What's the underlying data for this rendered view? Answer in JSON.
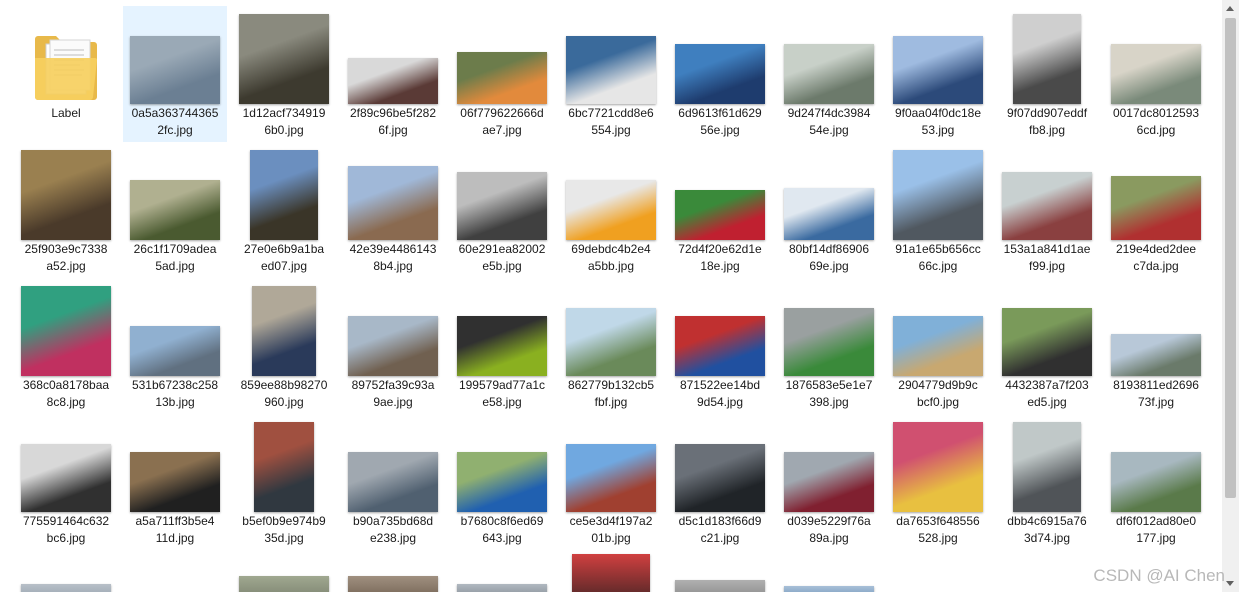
{
  "folder": {
    "name": "Label",
    "icon": "folder-icon"
  },
  "files": [
    {
      "line1": "0a5a363744365",
      "line2": "2fc.jpg",
      "c1": "#6b7f93",
      "c2": "#9aa9b6",
      "w": 90,
      "h": 68
    },
    {
      "line1": "1d12acf734919",
      "line2": "6b0.jpg",
      "c1": "#3d3a2f",
      "c2": "#8a8a7e",
      "w": 90,
      "h": 90
    },
    {
      "line1": "2f89c96be5f282",
      "line2": "6f.jpg",
      "c1": "#5a3a36",
      "c2": "#d9d9d9",
      "w": 90,
      "h": 46
    },
    {
      "line1": "06f779622666d",
      "line2": "ae7.jpg",
      "c1": "#e28a3c",
      "c2": "#6c7c4b",
      "w": 90,
      "h": 52
    },
    {
      "line1": "6bc7721cdd8e6",
      "line2": "554.jpg",
      "c1": "#e6e6e6",
      "c2": "#3a6a9b",
      "w": 90,
      "h": 68
    },
    {
      "line1": "6d9613f61d629",
      "line2": "56e.jpg",
      "c1": "#1e3c6e",
      "c2": "#3f7fbf",
      "w": 90,
      "h": 60
    },
    {
      "line1": "9d247f4dc3984",
      "line2": "54e.jpg",
      "c1": "#6c7a6b",
      "c2": "#c8d0c8",
      "w": 90,
      "h": 60
    },
    {
      "line1": "9f0aa04f0dc18e",
      "line2": "53.jpg",
      "c1": "#2c4a7a",
      "c2": "#9fbbe0",
      "w": 90,
      "h": 68
    },
    {
      "line1": "9f07dd907eddf",
      "line2": "fb8.jpg",
      "c1": "#4a4a4a",
      "c2": "#cfcfcf",
      "w": 68,
      "h": 90
    },
    {
      "line1": "0017dc8012593",
      "line2": "6cd.jpg",
      "c1": "#7a8a7a",
      "c2": "#d8d4c8",
      "w": 90,
      "h": 60
    },
    {
      "line1": "25f903e9c7338",
      "line2": "a52.jpg",
      "c1": "#4a3a2a",
      "c2": "#9a8050",
      "w": 90,
      "h": 90
    },
    {
      "line1": "26c1f1709adea",
      "line2": "5ad.jpg",
      "c1": "#4a5a30",
      "c2": "#b0b090",
      "w": 90,
      "h": 60
    },
    {
      "line1": "27e0e6b9a1ba",
      "line2": "ed07.jpg",
      "c1": "#3a3528",
      "c2": "#6b8fbf",
      "w": 68,
      "h": 90
    },
    {
      "line1": "42e39e4486143",
      "line2": "8b4.jpg",
      "c1": "#8a6a50",
      "c2": "#a0b8d8",
      "w": 90,
      "h": 74
    },
    {
      "line1": "60e291ea82002",
      "line2": "e5b.jpg",
      "c1": "#404040",
      "c2": "#bdbdbd",
      "w": 90,
      "h": 68
    },
    {
      "line1": "69debdc4b2e4",
      "line2": "a5bb.jpg",
      "c1": "#f0a020",
      "c2": "#e8e8e8",
      "w": 90,
      "h": 60
    },
    {
      "line1": "72d4f20e62d1e",
      "line2": "18e.jpg",
      "c1": "#c02030",
      "c2": "#3a8a3a",
      "w": 90,
      "h": 50
    },
    {
      "line1": "80bf14df86906",
      "line2": "69e.jpg",
      "c1": "#3a6aa0",
      "c2": "#e0e8f0",
      "w": 90,
      "h": 52
    },
    {
      "line1": "91a1e65b656cc",
      "line2": "66c.jpg",
      "c1": "#505860",
      "c2": "#9ac0e8",
      "w": 90,
      "h": 90
    },
    {
      "line1": "153a1a841d1ae",
      "line2": "f99.jpg",
      "c1": "#8a4040",
      "c2": "#c8d0d0",
      "w": 90,
      "h": 68
    },
    {
      "line1": "219e4ded2dee",
      "line2": "c7da.jpg",
      "c1": "#b03030",
      "c2": "#8a9a60",
      "w": 90,
      "h": 64
    },
    {
      "line1": "368c0a8178baa",
      "line2": "8c8.jpg",
      "c1": "#c03060",
      "c2": "#30a080",
      "w": 90,
      "h": 90
    },
    {
      "line1": "531b67238c258",
      "line2": "13b.jpg",
      "c1": "#607080",
      "c2": "#90b0d0",
      "w": 90,
      "h": 50
    },
    {
      "line1": "859ee88b98270",
      "line2": "960.jpg",
      "c1": "#2a3a5a",
      "c2": "#b0a898",
      "w": 64,
      "h": 90
    },
    {
      "line1": "89752fa39c93a",
      "line2": "9ae.jpg",
      "c1": "#706050",
      "c2": "#a8b8c8",
      "w": 90,
      "h": 60
    },
    {
      "line1": "199579ad77a1c",
      "line2": "e58.jpg",
      "c1": "#8ab020",
      "c2": "#303030",
      "w": 90,
      "h": 60
    },
    {
      "line1": "862779b132cb5",
      "line2": "fbf.jpg",
      "c1": "#6a8a5a",
      "c2": "#c0d8e8",
      "w": 90,
      "h": 68
    },
    {
      "line1": "871522ee14bd",
      "line2": "9d54.jpg",
      "c1": "#2050a0",
      "c2": "#c03030",
      "w": 90,
      "h": 60
    },
    {
      "line1": "1876583e5e1e7",
      "line2": "398.jpg",
      "c1": "#3a8a3a",
      "c2": "#9aa0a0",
      "w": 90,
      "h": 68
    },
    {
      "line1": "2904779d9b9c",
      "line2": "bcf0.jpg",
      "c1": "#c8a870",
      "c2": "#80b0d8",
      "w": 90,
      "h": 60
    },
    {
      "line1": "4432387a7f203",
      "line2": "ed5.jpg",
      "c1": "#303030",
      "c2": "#7a9a5a",
      "w": 90,
      "h": 68
    },
    {
      "line1": "8193811ed2696",
      "line2": "73f.jpg",
      "c1": "#6a7a6a",
      "c2": "#b8c8d8",
      "w": 90,
      "h": 42
    },
    {
      "line1": "775591464c632",
      "line2": "bc6.jpg",
      "c1": "#303030",
      "c2": "#d8d8d8",
      "w": 90,
      "h": 68
    },
    {
      "line1": "a5a711ff3b5e4",
      "line2": "11d.jpg",
      "c1": "#202020",
      "c2": "#8a7050",
      "w": 90,
      "h": 60
    },
    {
      "line1": "b5ef0b9e974b9",
      "line2": "35d.jpg",
      "c1": "#303840",
      "c2": "#a05040",
      "w": 60,
      "h": 90
    },
    {
      "line1": "b90a735bd68d",
      "line2": "e238.jpg",
      "c1": "#506070",
      "c2": "#a0a8b0",
      "w": 90,
      "h": 60
    },
    {
      "line1": "b7680c8f6ed69",
      "line2": "643.jpg",
      "c1": "#2060b0",
      "c2": "#90b070",
      "w": 90,
      "h": 60
    },
    {
      "line1": "ce5e3d4f197a2",
      "line2": "01b.jpg",
      "c1": "#a04030",
      "c2": "#70a8e0",
      "w": 90,
      "h": 68
    },
    {
      "line1": "d5c1d183f66d9",
      "line2": "c21.jpg",
      "c1": "#202428",
      "c2": "#6a7078",
      "w": 90,
      "h": 68
    },
    {
      "line1": "d039e5229f76a",
      "line2": "89a.jpg",
      "c1": "#802030",
      "c2": "#a0a8b0",
      "w": 90,
      "h": 60
    },
    {
      "line1": "da7653f648556",
      "line2": "528.jpg",
      "c1": "#e8c040",
      "c2": "#d05070",
      "w": 90,
      "h": 90
    },
    {
      "line1": "dbb4c6915a76",
      "line2": "3d74.jpg",
      "c1": "#505458",
      "c2": "#c0c8c8",
      "w": 68,
      "h": 90
    },
    {
      "line1": "df6f012ad80e0",
      "line2": "177.jpg",
      "c1": "#5a7a4a",
      "c2": "#a8b8c0",
      "w": 90,
      "h": 60
    }
  ],
  "partial_row": [
    {
      "c1": "#7a8a9a",
      "c2": "#b8c0c8"
    },
    {
      "c1": "#6a7060",
      "c2": "#a0a890"
    },
    {
      "c1": "#5a4a3a",
      "c2": "#a09080"
    },
    {
      "c1": "#606870",
      "c2": "#b0b8c0"
    },
    {
      "c1": "#302020",
      "c2": "#d04040"
    },
    {
      "c1": "#707070",
      "c2": "#b0b0b0"
    },
    {
      "c1": "#3a6a9a",
      "c2": "#a8c0d8"
    }
  ],
  "watermark": "CSDN @AI Chen"
}
